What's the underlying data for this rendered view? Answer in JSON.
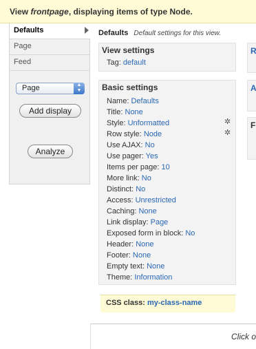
{
  "header": {
    "prefix": "View ",
    "view_name": "frontpage",
    "suffix": ", displaying items of type Node."
  },
  "sidebar": {
    "tabs": [
      {
        "label": "Defaults",
        "active": true
      },
      {
        "label": "Page",
        "active": false
      },
      {
        "label": "Feed",
        "active": false
      }
    ],
    "display_select": {
      "value": "Page",
      "icon": "stepper-arrows-icon"
    },
    "add_display_label": "Add display",
    "analyze_label": "Analyze"
  },
  "main": {
    "section_title": "Defaults",
    "section_desc": "Default settings for this view.",
    "view_settings": {
      "title": "View settings",
      "tag_label": "Tag:",
      "tag_value": "default"
    },
    "basic_settings": {
      "title": "Basic settings",
      "rows": [
        {
          "label": "Name:",
          "value": "Defaults"
        },
        {
          "label": "Title:",
          "value": "None"
        },
        {
          "label": "Style:",
          "value": "Unformatted",
          "gear": true
        },
        {
          "label": "Row style:",
          "value": "Node",
          "gear": true
        },
        {
          "label": "Use AJAX:",
          "value": "No"
        },
        {
          "label": "Use pager:",
          "value": "Yes"
        },
        {
          "label": "Items per page:",
          "value": "10"
        },
        {
          "label": "More link:",
          "value": "No"
        },
        {
          "label": "Distinct:",
          "value": "No"
        },
        {
          "label": "Access:",
          "value": "Unrestricted"
        },
        {
          "label": "Caching:",
          "value": "None"
        },
        {
          "label": "Link display:",
          "value": "Page"
        },
        {
          "label": "Exposed form in block:",
          "value": "No"
        },
        {
          "label": "Header:",
          "value": "None"
        },
        {
          "label": "Footer:",
          "value": "None"
        },
        {
          "label": "Empty text:",
          "value": "None"
        },
        {
          "label": "Theme:",
          "value": "Information"
        }
      ]
    },
    "css_class": {
      "label": "CSS class:",
      "value": "my-class-name"
    },
    "right_panels": [
      "R",
      "A",
      "F"
    ],
    "footer_hint": "Click o"
  },
  "colors": {
    "link": "#2a68b5",
    "header_bg": "#fffbd6",
    "panel_bg": "#f3f3f3"
  }
}
